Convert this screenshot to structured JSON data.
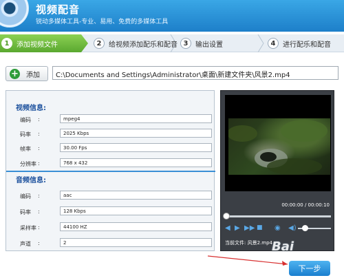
{
  "header": {
    "title": "视频配音",
    "subtitle": "锐动多媒体工具-专业、易用、免费的多媒体工具"
  },
  "steps": [
    {
      "num": "1",
      "label": "添加视频文件"
    },
    {
      "num": "2",
      "label": "给视频添加配乐和配音"
    },
    {
      "num": "3",
      "label": "输出设置"
    },
    {
      "num": "4",
      "label": "进行配乐和配音"
    }
  ],
  "toolbar": {
    "add_label": "添加",
    "file_path": "C:\\Documents and Settings\\Administrator\\桌面\\新建文件夹\\风景2.mp4"
  },
  "video_info": {
    "title": "视频信息:",
    "rows": [
      {
        "label": "编码",
        "value": "mpeg4"
      },
      {
        "label": "码率",
        "value": "2025 Kbps"
      },
      {
        "label": "帧率",
        "value": "30.00 Fps"
      },
      {
        "label": "分辨率",
        "value": "768 x 432"
      }
    ]
  },
  "audio_info": {
    "title": "音频信息:",
    "rows": [
      {
        "label": "编码",
        "value": "aac"
      },
      {
        "label": "码率",
        "value": "128 Kbps"
      },
      {
        "label": "采样率",
        "value": "44100 HZ"
      },
      {
        "label": "声道",
        "value": "2"
      }
    ]
  },
  "player": {
    "time": "00:00:00 / 00:00:10",
    "current_file_label": "当前文件:",
    "current_file": "风景2.mp4"
  },
  "footer": {
    "next_label": "下一步",
    "watermark": "baidu"
  },
  "colors": {
    "header": "#1d7fc9",
    "step_active": "#5aa830",
    "section_title": "#1a4f9c",
    "divider": "#3a8fd6",
    "player_bg": "#3b3f45",
    "arrow": "#d83030"
  },
  "icons": {
    "add": "plus-circle-icon",
    "play": "play-icon",
    "stop": "stop-icon",
    "rewind": "rewind-icon",
    "forward": "forward-icon",
    "camera": "camera-icon",
    "volume": "volume-icon"
  }
}
